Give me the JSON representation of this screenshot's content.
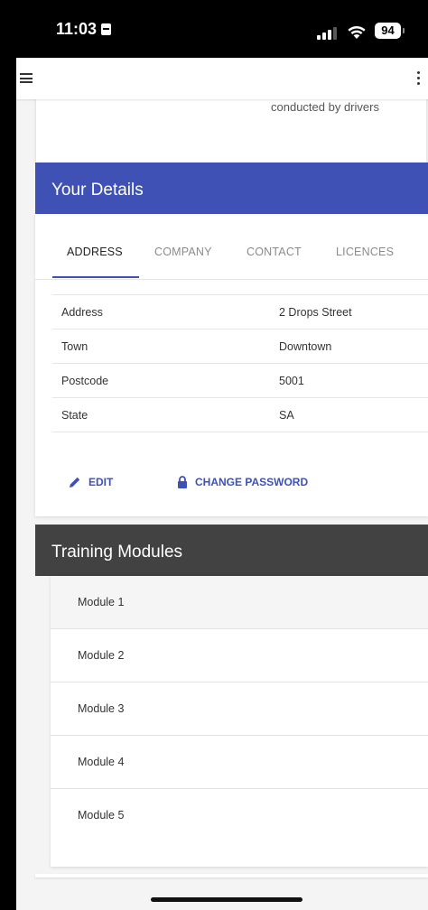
{
  "status_bar": {
    "time": "11:03",
    "battery": "94"
  },
  "previous_card": {
    "text": "conducted by drivers"
  },
  "details": {
    "title": "Your Details",
    "tabs": [
      {
        "label": "ADDRESS"
      },
      {
        "label": "COMPANY"
      },
      {
        "label": "CONTACT"
      },
      {
        "label": "LICENCES"
      }
    ],
    "active_tab": "ADDRESS",
    "rows": [
      {
        "key": "Address",
        "value": "2 Drops Street"
      },
      {
        "key": "Town",
        "value": "Downtown"
      },
      {
        "key": "Postcode",
        "value": "5001"
      },
      {
        "key": "State",
        "value": "SA"
      }
    ],
    "edit_label": "EDIT",
    "change_password_label": "CHANGE PASSWORD"
  },
  "training": {
    "title": "Training Modules",
    "modules": [
      {
        "label": "Module 1"
      },
      {
        "label": "Module 2"
      },
      {
        "label": "Module 3"
      },
      {
        "label": "Module 4"
      },
      {
        "label": "Module 5"
      }
    ]
  },
  "icons": {
    "menu": "menu-icon",
    "more": "more-vert-icon",
    "edit": "pencil-icon",
    "password": "lock-icon"
  },
  "colors": {
    "primary": "#3f51b5",
    "training_header": "#424242"
  }
}
